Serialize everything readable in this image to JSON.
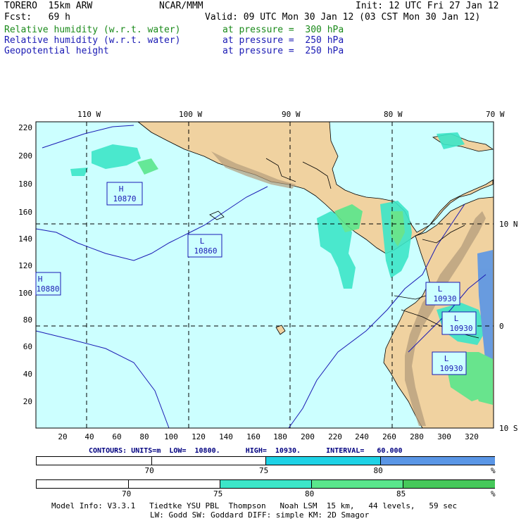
{
  "header": {
    "model": "TORERO  15km ARW",
    "org": "NCAR/MMM",
    "init": "Init: 12 UTC Fri 27 Jan 12",
    "fcst": "Fcst:   69 h",
    "valid": "Valid: 09 UTC Mon 30 Jan 12 (03 CST Mon 30 Jan 12)",
    "fields": [
      {
        "name": "Relative humidity (w.r.t. water)",
        "level": "at pressure =  300 hPa",
        "color": "#1a8a1a"
      },
      {
        "name": "Relative humidity (w.r.t. water)",
        "level": "at pressure =  250 hPa",
        "color": "#1a1ab4"
      },
      {
        "name": "Geopotential height",
        "level": "at pressure =  250 hPa",
        "color": "#1a1ab4"
      }
    ]
  },
  "map": {
    "lon_labels": [
      "110 W",
      "100 W",
      "90 W",
      "80 W",
      "70 W"
    ],
    "lat_labels": [
      "10 N",
      "0",
      "10 S"
    ],
    "y_ticks": [
      "220",
      "200",
      "180",
      "160",
      "140",
      "120",
      "100",
      "80",
      "60",
      "40",
      "20"
    ],
    "x_ticks": [
      "20",
      "40",
      "60",
      "80",
      "100",
      "120",
      "140",
      "160",
      "180",
      "200",
      "220",
      "240",
      "260",
      "280",
      "300",
      "320"
    ],
    "centers": [
      {
        "type": "H",
        "value": "10870"
      },
      {
        "type": "L",
        "value": "10860"
      },
      {
        "type": "H",
        "value": "10880"
      },
      {
        "type": "L",
        "value": "10930"
      },
      {
        "type": "L",
        "value": "10930"
      },
      {
        "type": "L",
        "value": "10930"
      }
    ],
    "colors": {
      "ocean": "#ccffff",
      "land": "#f0d2a0",
      "mountain": "#b49c7c"
    }
  },
  "contours_caption": "CONTOURS: UNITS=m  LOW=  10800.      HIGH=  10930.      INTERVAL=   60.000",
  "colorbars": [
    {
      "ticks": [
        "70",
        "75",
        "80",
        "%"
      ],
      "colors": [
        "#ffffff",
        "#ffffff",
        "#1ed2e6",
        "#5a96e6"
      ]
    },
    {
      "ticks": [
        "70",
        "75",
        "80",
        "85",
        "%"
      ],
      "colors": [
        "#ffffff",
        "#ffffff",
        "#3ce6c8",
        "#5ae68c",
        "#46c85a"
      ]
    }
  ],
  "footer": {
    "line1": "Model Info: V3.3.1   Tiedtke YSU PBL  Thompson   Noah LSM  15 km,   44 levels,   59 sec",
    "line2": "LW: Godd SW: Goddard DIFF: simple KM: 2D Smagor"
  }
}
